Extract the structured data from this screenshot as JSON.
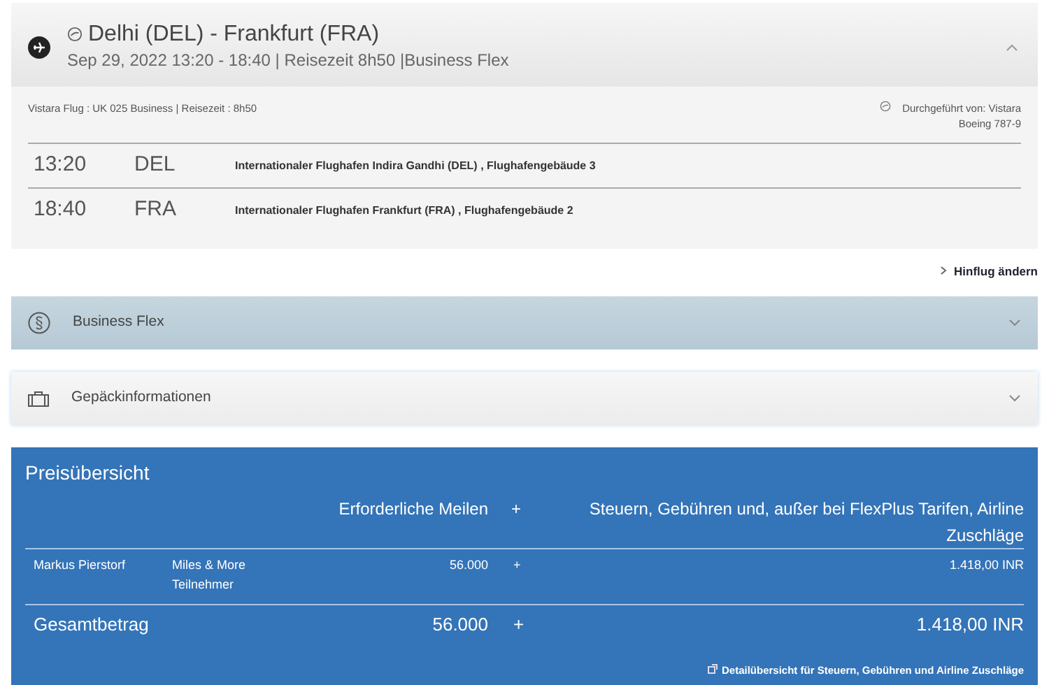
{
  "flight": {
    "title": "Delhi (DEL) - Frankfurt (FRA)",
    "subtitle": "Sep 29, 2022 13:20 - 18:40 | Reisezeit 8h50 |Business Flex",
    "expanded": true,
    "info": "Vistara Flug : UK 025 Business | Reisezeit : 8h50",
    "operated_by": "Durchgeführt von: Vistara",
    "aircraft": "Boeing 787-9",
    "segments": [
      {
        "time": "13:20",
        "code": "DEL",
        "airport": "Internationaler Flughafen Indira Gandhi (DEL) , Flughafengebäude 3"
      },
      {
        "time": "18:40",
        "code": "FRA",
        "airport": "Internationaler Flughafen Frankfurt (FRA) , Flughafengebäude 2"
      }
    ]
  },
  "change_link": "Hinflug ändern",
  "panels": [
    {
      "kind": "fare",
      "label": "Business Flex",
      "expanded": false
    },
    {
      "kind": "baggage",
      "label": "Gepäckinformationen",
      "expanded": false
    }
  ],
  "price": {
    "title": "Preisübersicht",
    "columns": [
      "Erforderliche Meilen",
      "+",
      "Steuern, Gebühren und, außer bei FlexPlus Tarifen, Airline Zuschläge"
    ],
    "rows": [
      {
        "name": "Markus Pierstorf",
        "type": "Miles & More Teilnehmer",
        "miles": "56.000",
        "plus": "+",
        "amount": "1.418,00 INR"
      }
    ],
    "total": {
      "label": "Gesamtbetrag",
      "miles": "56.000",
      "plus": "+",
      "amount": "1.418,00 INR"
    },
    "details_link": "Detailübersicht für Steuern, Gebühren und Airline Zuschläge"
  }
}
